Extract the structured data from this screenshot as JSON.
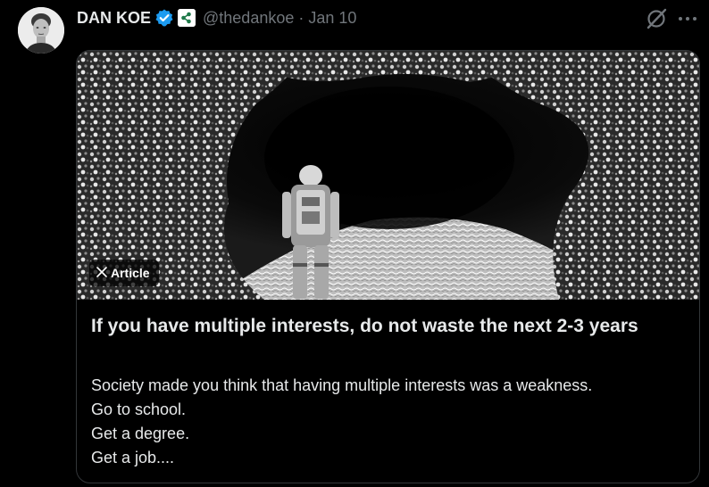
{
  "author": {
    "display_name": "DAN KOE",
    "handle": "@thedankoe",
    "separator": "·",
    "timestamp": "Jan 10",
    "verified_icon": "verified-badge-icon",
    "affiliate_icon": "affiliate-badge-icon"
  },
  "actions": {
    "grok_icon": "grok-icon",
    "more_icon": "more-icon"
  },
  "article": {
    "badge_label": "Article",
    "title": "If you have multiple interests, do not waste the next 2-3 years",
    "preview_lines": [
      "Society made you think that having multiple interests was a weakness.",
      "Go to school.",
      "Get a degree.",
      "Get a job...."
    ]
  },
  "colors": {
    "background": "#000000",
    "text_primary": "#e7e9ea",
    "text_secondary": "#71767b",
    "verified_blue": "#1d9bf0",
    "border": "#333639"
  }
}
